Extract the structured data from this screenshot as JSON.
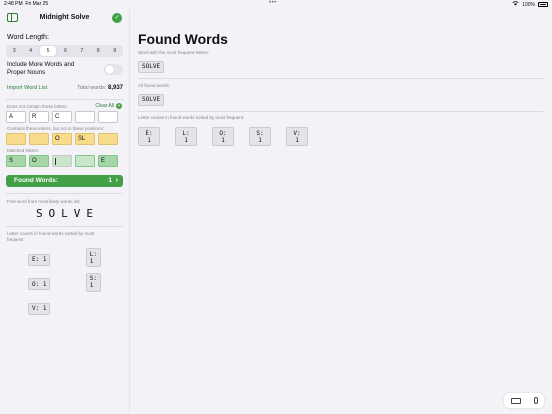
{
  "status": {
    "time": "2:48 PM",
    "date": "Fri Mar 25",
    "battery": "100%"
  },
  "sidebar": {
    "title": "Midnight Solve",
    "word_length_label": "Word Length:",
    "lengths": [
      "3",
      "4",
      "5",
      "6",
      "7",
      "8",
      "9"
    ],
    "selected_length": "5",
    "more_words_label": "Include More Words and Proper Nouns",
    "more_words_on": false,
    "import_label": "Import Word List",
    "total_label": "Total words:",
    "total_value": "8,937",
    "excluded_label": "Does not contain these letters:",
    "clear_all": "Clear All",
    "excluded": [
      "A",
      "R",
      "C",
      "",
      ""
    ],
    "misplaced_label": "Contains these letters, but not in these positions:",
    "misplaced": [
      "",
      "",
      "O",
      "SL",
      ""
    ],
    "matched_label": "Matched letters:",
    "matched": [
      "S",
      "O",
      "",
      "",
      "E"
    ],
    "found_label": "Found Words:",
    "found_count": "1",
    "first_word_label": "First word from most likely words list:",
    "first_word": "SOLVE",
    "counts_label": "Letter counts in found words sorted by most frequent:",
    "counts": [
      "E: 1",
      "L: 1",
      "O: 1",
      "S: 1",
      "V: 1"
    ]
  },
  "main": {
    "title": "Found Words",
    "freq_label": "Word with the most frequent letters:",
    "freq_word": "SOLVE",
    "all_label": "All found words:",
    "all_words": [
      "SOLVE"
    ],
    "counts_label": "Letter counts in found words sorted by most frequent:",
    "counts": [
      "E: 1",
      "L: 1",
      "O: 1",
      "S: 1",
      "V: 1"
    ]
  },
  "icons": [
    "sidebar-toggle-icon",
    "status-check-icon",
    "plus-icon",
    "chevron-right-icon",
    "keyboard-icon",
    "mic-icon",
    "wifi-icon",
    "battery-icon"
  ],
  "colors": {
    "accent": "#43a047",
    "misplaced": "#f8dc8c",
    "matched": "#a5d6a7"
  }
}
